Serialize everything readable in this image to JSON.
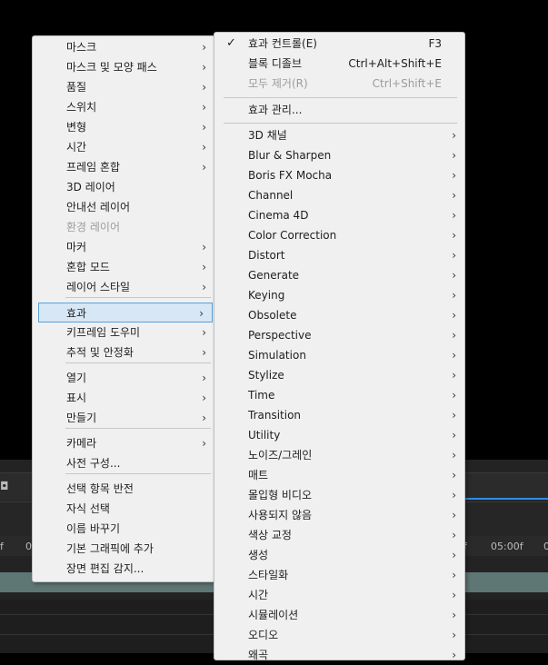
{
  "background": {
    "ruler_labels": [
      "f",
      "00",
      "f",
      "05:00f",
      "0"
    ]
  },
  "main_menu": {
    "items": [
      {
        "label": "마스크",
        "submenu": true
      },
      {
        "label": "마스크 및 모양 패스",
        "submenu": true
      },
      {
        "label": "품질",
        "submenu": true
      },
      {
        "label": "스위치",
        "submenu": true
      },
      {
        "label": "변형",
        "submenu": true
      },
      {
        "label": "시간",
        "submenu": true
      },
      {
        "label": "프레임 혼합",
        "submenu": true
      },
      {
        "label": "3D 레이어",
        "submenu": false
      },
      {
        "label": "안내선 레이어",
        "submenu": false
      },
      {
        "label": "환경 레이어",
        "submenu": false,
        "disabled": true
      },
      {
        "label": "마커",
        "submenu": true
      },
      {
        "label": "혼합 모드",
        "submenu": true
      },
      {
        "label": "레이어 스타일",
        "submenu": true
      },
      {
        "label": "효과",
        "submenu": true,
        "highlight": true
      },
      {
        "label": "키프레임 도우미",
        "submenu": true
      },
      {
        "label": "추적 및 안정화",
        "submenu": true
      },
      {
        "label": "열기",
        "submenu": true
      },
      {
        "label": "표시",
        "submenu": true
      },
      {
        "label": "만들기",
        "submenu": true
      },
      {
        "label": "카메라",
        "submenu": true
      },
      {
        "label": "사전 구성...",
        "submenu": false
      },
      {
        "label": "선택 항목 반전",
        "submenu": false
      },
      {
        "label": "자식 선택",
        "submenu": false
      },
      {
        "label": "이름 바꾸기",
        "submenu": false
      },
      {
        "label": "기본 그래픽에 추가",
        "submenu": false
      },
      {
        "label": "장면 편집 감지...",
        "submenu": false
      }
    ]
  },
  "effects_menu": {
    "top_items": [
      {
        "label": "효과 컨트롤(E)",
        "shortcut": "F3",
        "checked": true
      },
      {
        "label": "블록 디졸브",
        "shortcut": "Ctrl+Alt+Shift+E"
      },
      {
        "label": "모두 제거(R)",
        "shortcut": "Ctrl+Shift+E",
        "disabled": true
      }
    ],
    "manage_label": "효과 관리...",
    "categories": [
      "3D 채널",
      "Blur & Sharpen",
      "Boris FX Mocha",
      "Channel",
      "Cinema 4D",
      "Color Correction",
      "Distort",
      "Generate",
      "Keying",
      "Obsolete",
      "Perspective",
      "Simulation",
      "Stylize",
      "Time",
      "Transition",
      "Utility",
      "노이즈/그레인",
      "매트",
      "몰입형 비디오",
      "사용되지 않음",
      "색상 교정",
      "생성",
      "스타일화",
      "시간",
      "시뮬레이션",
      "오디오",
      "왜곡"
    ],
    "check_glyph": "✓",
    "arrow_glyph": "›"
  }
}
